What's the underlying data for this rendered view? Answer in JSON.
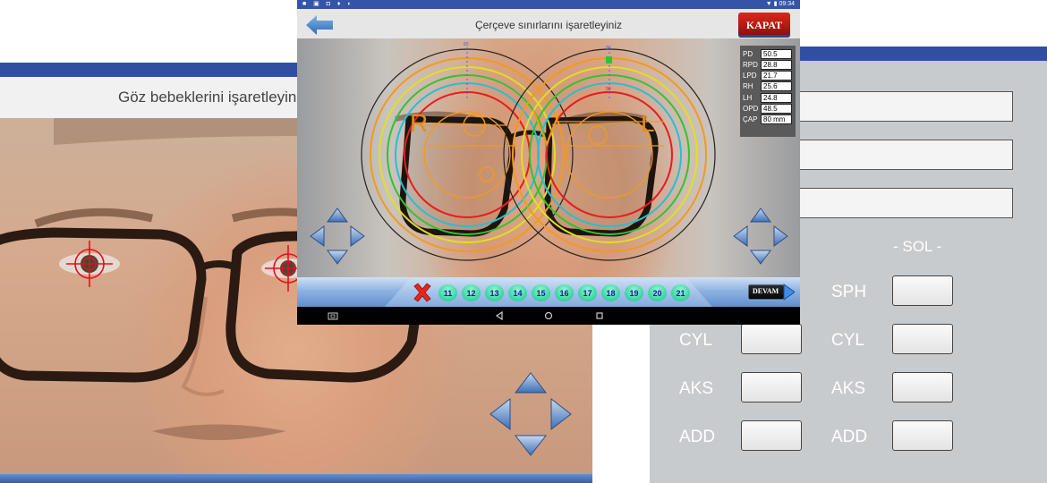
{
  "left_screen": {
    "title": "Göz bebeklerini işaretleyiniz"
  },
  "center_screen": {
    "title": "Çerçeve sınırlarını işaretleyiniz",
    "status_time": "09:34",
    "close_button": "KAPAT",
    "continue_button": "DEVAM",
    "lens_labels": {
      "right": "R",
      "left": "L"
    },
    "measurements": [
      {
        "label": "PD",
        "value": "50.5"
      },
      {
        "label": "RPD",
        "value": "28.8"
      },
      {
        "label": "LPD",
        "value": "21.7"
      },
      {
        "label": "RH",
        "value": "25.6"
      },
      {
        "label": "LH",
        "value": "24.8"
      },
      {
        "label": "OPD",
        "value": "48.5"
      },
      {
        "label": "ÇAP",
        "value": "80 mm"
      }
    ],
    "lens_sizes": [
      "11",
      "12",
      "13",
      "14",
      "15",
      "16",
      "17",
      "18",
      "19",
      "20",
      "21"
    ]
  },
  "right_screen": {
    "side_header": "- SOL -",
    "right_labels": [
      "CYL",
      "AKS",
      "ADD"
    ],
    "left_labels": [
      "SPH",
      "CYL",
      "AKS",
      "ADD"
    ]
  },
  "colors": {
    "accent_blue": "#2f4fa3",
    "close_red": "#c0201a",
    "size_button_green": "#3fd9a6",
    "prescription_bg": "#c8cbcd"
  }
}
